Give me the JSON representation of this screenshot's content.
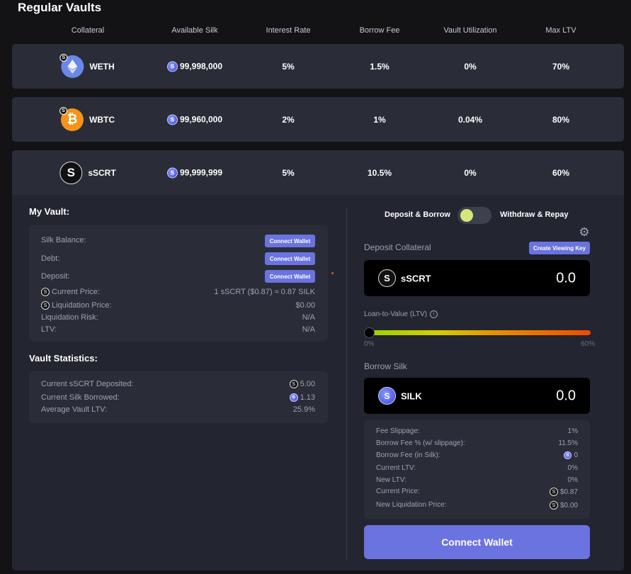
{
  "page_title": "Regular Vaults",
  "columns": [
    "Collateral",
    "Available Silk",
    "Interest Rate",
    "Borrow Fee",
    "Vault Utilization",
    "Max LTV"
  ],
  "vaults": [
    {
      "collateral": "WETH",
      "available": "99,998,000",
      "interest": "5%",
      "fee": "1.5%",
      "util": "0%",
      "max_ltv": "70%"
    },
    {
      "collateral": "WBTC",
      "available": "99,960,000",
      "interest": "2%",
      "fee": "1%",
      "util": "0.04%",
      "max_ltv": "80%"
    },
    {
      "collateral": "sSCRT",
      "available": "99,999,999",
      "interest": "5%",
      "fee": "10.5%",
      "util": "0%",
      "max_ltv": "60%"
    }
  ],
  "my_vault": {
    "title": "My Vault:",
    "silk_balance": "Silk Balance:",
    "debt": "Debt:",
    "deposit": "Deposit:",
    "connect_wallet_small": "Connect Wallet",
    "current_price_label": "Current Price:",
    "current_price_value": "1 sSCRT ($0.87) ≈ 0.87 SILK",
    "liq_price_label": "Liquidation Price:",
    "liq_price_value": "$0.00",
    "liq_risk_label": "Liquidation Risk:",
    "liq_risk_value": "N/A",
    "ltv_label": "LTV:",
    "ltv_value": "N/A"
  },
  "stats": {
    "title": "Vault Statistics:",
    "deposited_label": "Current sSCRT Deposited:",
    "deposited_value": "5.00",
    "borrowed_label": "Current Silk Borrowed:",
    "borrowed_value": "1.13",
    "avg_ltv_label": "Average Vault LTV:",
    "avg_ltv_value": "25.9%"
  },
  "panel": {
    "toggle_left": "Deposit & Borrow",
    "toggle_right": "Withdraw & Repay",
    "deposit_collateral": "Deposit Collateral",
    "create_key": "Create Viewing Key",
    "collateral_token": "sSCRT",
    "collateral_amount": "0.0",
    "ltv_label": "Loan-to-Value (LTV)",
    "ltv_min": "0%",
    "ltv_max": "60%",
    "ltv_value": 0,
    "borrow_silk": "Borrow Silk",
    "borrow_token": "SILK",
    "borrow_amount": "0.0",
    "details": [
      {
        "label": "Fee Slippage:",
        "value": "1%",
        "icon": ""
      },
      {
        "label": "Borrow Fee % (w/ slippage):",
        "value": "11.5%",
        "icon": ""
      },
      {
        "label": "Borrow Fee (in Silk):",
        "value": "0",
        "icon": "silk"
      },
      {
        "label": "Current LTV:",
        "value": "0%",
        "icon": ""
      },
      {
        "label": "New LTV:",
        "value": "0%",
        "icon": ""
      },
      {
        "label": "Current Price:",
        "value": "$0.87",
        "icon": "scrt"
      },
      {
        "label": "New Liquidation Price:",
        "value": "$0.00",
        "icon": "scrt"
      }
    ],
    "connect_wallet": "Connect Wallet"
  },
  "colors": {
    "accent": "#6a73e0",
    "row_bg": "#2a2d38",
    "bg": "#131316"
  }
}
